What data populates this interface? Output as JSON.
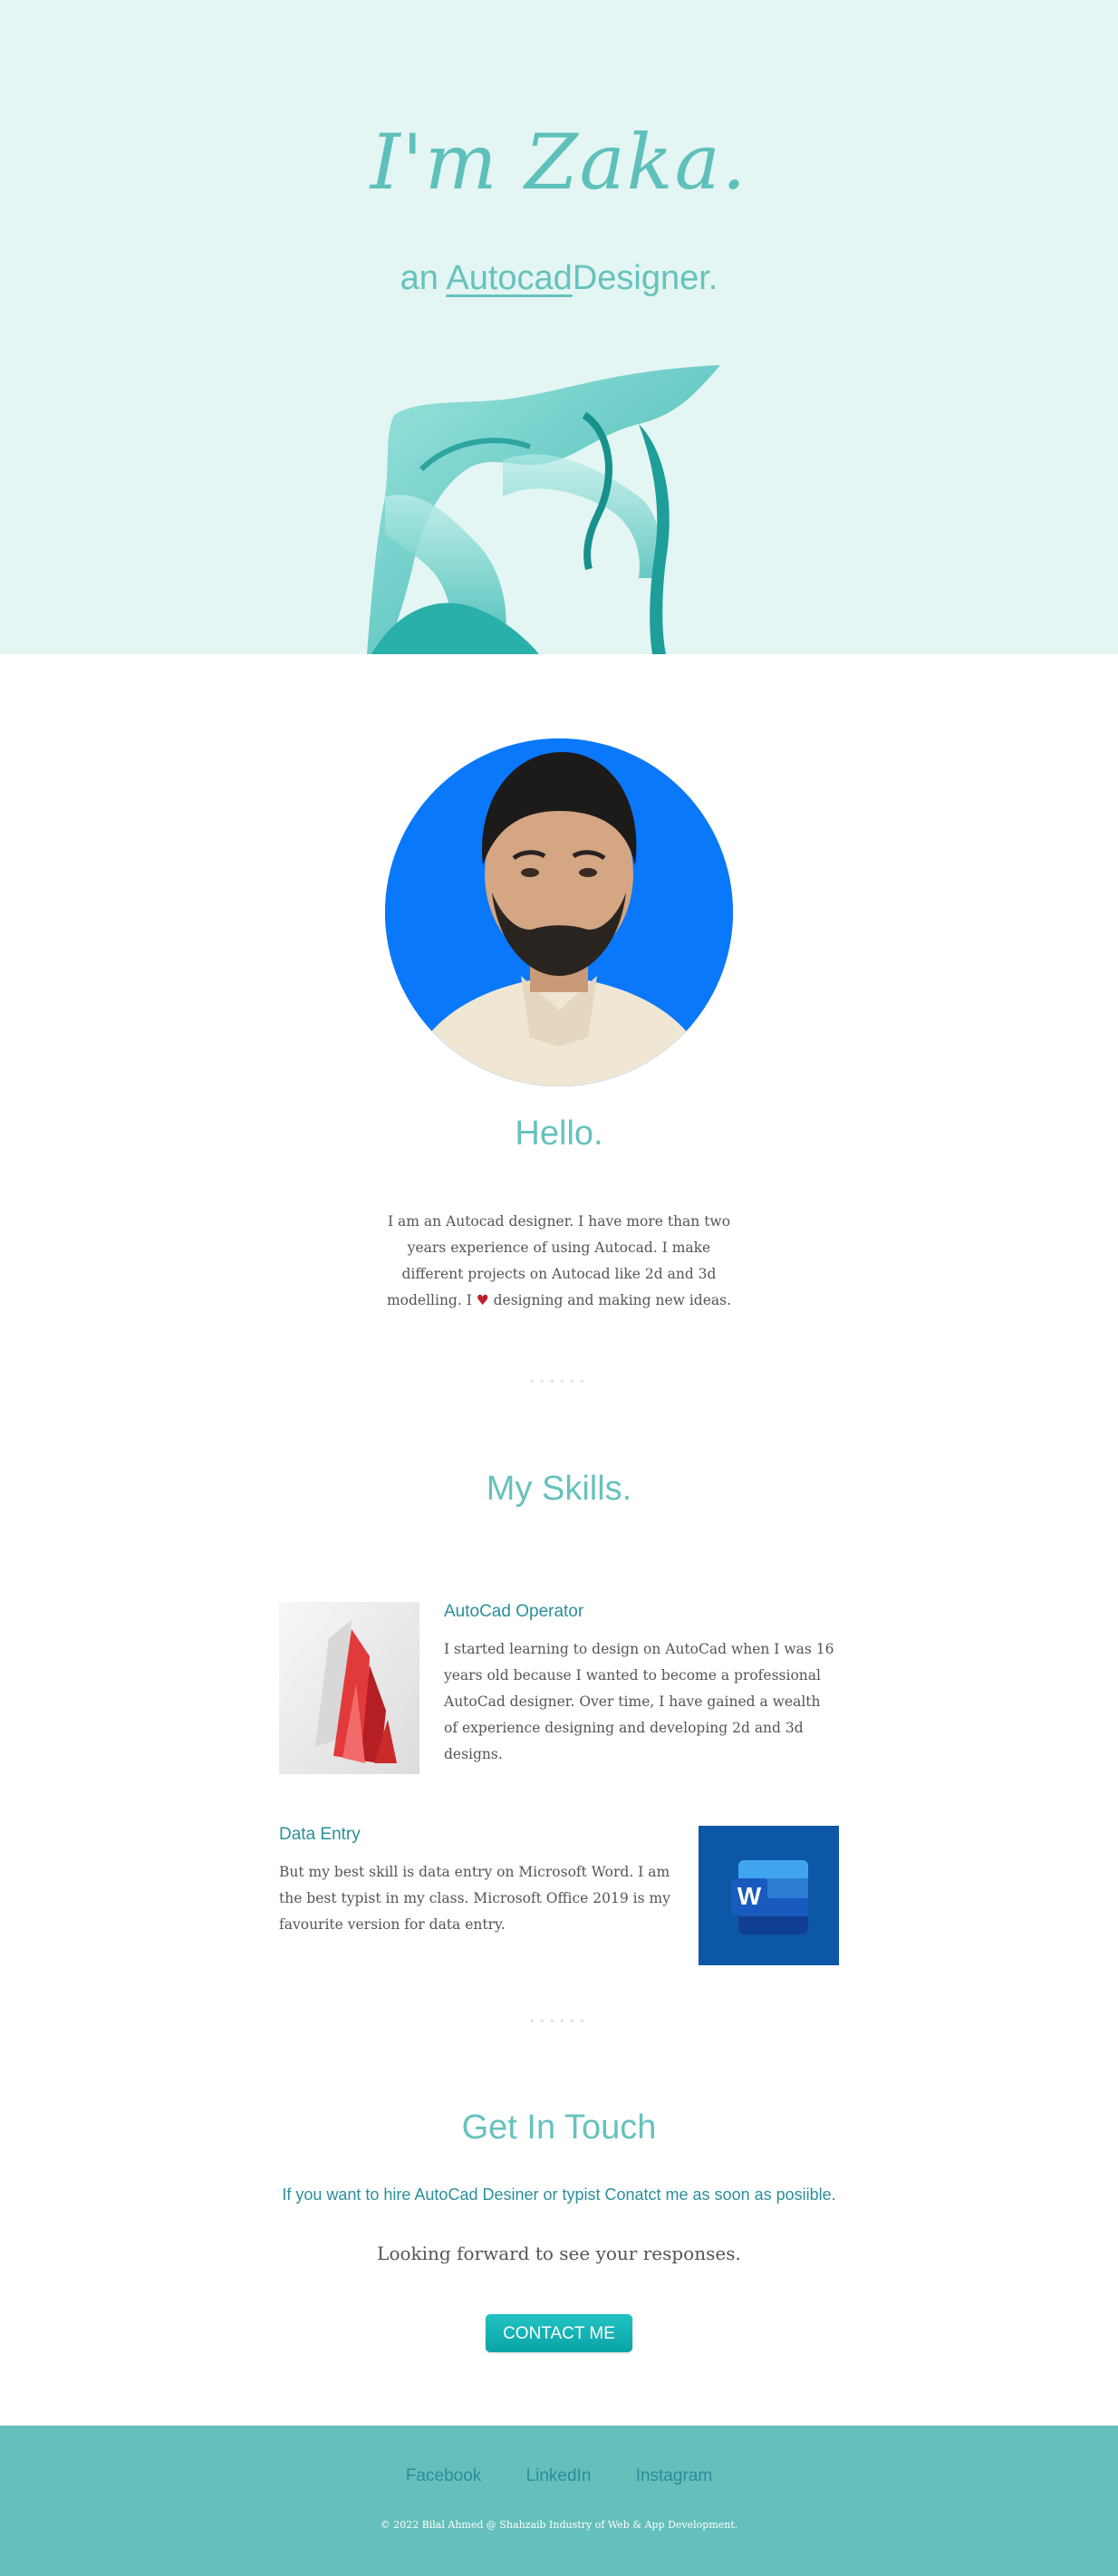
{
  "hero": {
    "title": "I'm Zaka.",
    "subtitle_prefix": "an ",
    "subtitle_role": "Autocad",
    "subtitle_suffix": "Designer."
  },
  "about": {
    "heading": "Hello.",
    "text_part1": "I am an Autocad designer. I have more than two years experience of using Autocad. I make different projects on Autocad like 2d and 3d modelling. I ",
    "heart": "♥",
    "text_part2": " designing and making new ideas."
  },
  "divider": "••••••",
  "skills": {
    "heading": "My Skills.",
    "items": [
      {
        "title": "AutoCad Operator",
        "text": "I started learning to design on AutoCad when I was 16 years old because I wanted to become a professional AutoCad designer. Over time, I have gained a wealth of experience designing and developing 2d and 3d designs.",
        "icon": "autocad-logo"
      },
      {
        "title": "Data Entry",
        "text": "But my best skill is data entry on Microsoft Word. I am the best typist in my class. Microsoft Office 2019 is my favourite version for data entry.",
        "icon": "word-logo",
        "icon_letter": "W"
      }
    ]
  },
  "contact": {
    "heading": "Get In Touch",
    "lead": "If you want to hire AutoCad Desiner or typist Conatct me as soon as posiible.",
    "forward": "Looking forward to see your responses.",
    "button": "CONTACT ME"
  },
  "footer": {
    "links": [
      "Facebook",
      "LinkedIn",
      "Instagram"
    ],
    "copyright": "© 2022 Bilal Ahmed @ Shahzaib Industry of Web & App Development."
  },
  "colors": {
    "hero_bg": "#e3f6f3",
    "accent": "#66c2bd",
    "accent_dark": "#2a8f9a",
    "footer_bg": "#65bfbb",
    "avatar_bg": "#0a78fa"
  }
}
